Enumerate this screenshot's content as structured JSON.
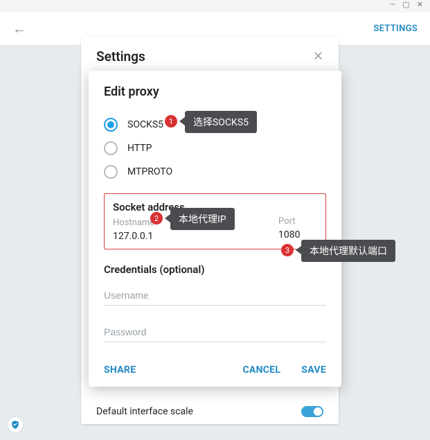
{
  "titlebar": {
    "min": "—",
    "max": "▢",
    "close": "✕"
  },
  "topbar": {
    "settings": "SETTINGS"
  },
  "settings_panel": {
    "title": "Settings",
    "scale_label": "Default interface scale"
  },
  "modal": {
    "title": "Edit proxy",
    "options": {
      "socks5": "SOCKS5",
      "http": "HTTP",
      "mtproto": "MTPROTO"
    },
    "address": {
      "section": "Socket address",
      "hostname_label": "Hostname",
      "hostname_value": "127.0.0.1",
      "port_label": "Port",
      "port_value": "1080"
    },
    "credentials": {
      "title": "Credentials (optional)",
      "username_ph": "Username",
      "password_ph": "Password"
    },
    "buttons": {
      "share": "SHARE",
      "cancel": "CANCEL",
      "save": "SAVE"
    }
  },
  "callouts": {
    "n1": "1",
    "t1": "选择SOCKS5",
    "n2": "2",
    "t2": "本地代理IP",
    "n3": "3",
    "t3": "本地代理默认端口"
  }
}
